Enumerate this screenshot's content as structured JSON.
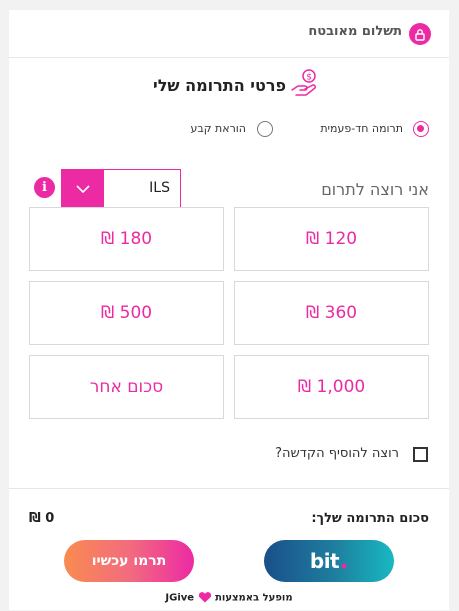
{
  "header": {
    "secure_payment_label": "תשלום מאובטח"
  },
  "section": {
    "title": "פרטי התרומה שלי"
  },
  "donation_type": {
    "options": [
      {
        "label": "תרומה חד-פעמית",
        "selected": true
      },
      {
        "label": "הוראת קבע",
        "selected": false
      }
    ]
  },
  "amount_picker": {
    "label": "אני רוצה לתרום",
    "currency": "ILS",
    "amounts": [
      "120 ₪",
      "180 ₪",
      "360 ₪",
      "500 ₪",
      "1,000 ₪",
      "סכום אחר"
    ]
  },
  "dedication": {
    "label": "רוצה להוסיף הקדשה?"
  },
  "summary": {
    "total_label": "סכום התרומה שלך:",
    "total_value": "0 ₪"
  },
  "actions": {
    "bit_label": "bit",
    "donate_label": "תרמו עכשיו"
  },
  "footer": {
    "powered_label": "מופעל באמצעות",
    "brand": "JGive"
  },
  "colors": {
    "accent": "#ec2aa4"
  }
}
